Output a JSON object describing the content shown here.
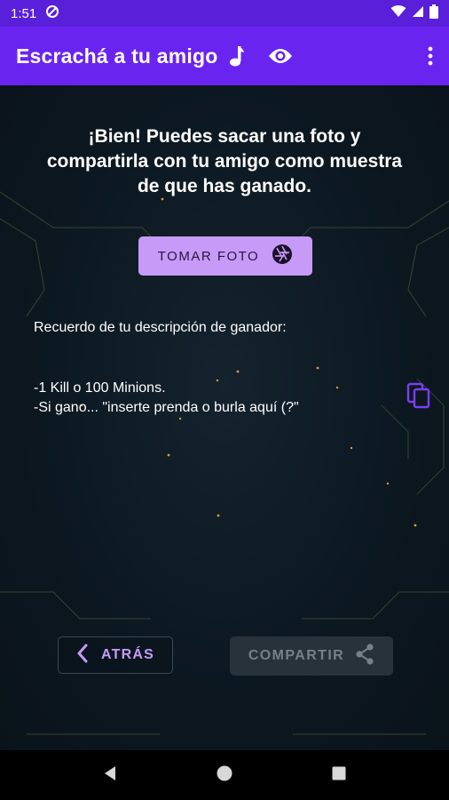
{
  "status_bar": {
    "time": "1:51"
  },
  "app_bar": {
    "title": "Escrachá a tu amigo",
    "icons": [
      "music-icon",
      "eye-icon",
      "more-vert-icon"
    ]
  },
  "main": {
    "headline": "¡Bien! Puedes sacar una foto y compartirla con tu amigo como muestra de que has ganado.",
    "take_photo_label": "TOMAR FOTO",
    "winner_label": "Recuerdo de tu descripción de ganador:",
    "description_lines": [
      "-1 Kill o 100 Minions.",
      "-Si gano... \"inserte prenda o burla aquí (?\""
    ]
  },
  "actions": {
    "back_label": "ATRÁS",
    "share_label": "COMPARTIR"
  },
  "colors": {
    "status_bar": "#5a1fd9",
    "app_bar": "#6a24f0",
    "accent": "#c79af7",
    "background": "#0d1720",
    "share_disabled": "#28323b"
  }
}
